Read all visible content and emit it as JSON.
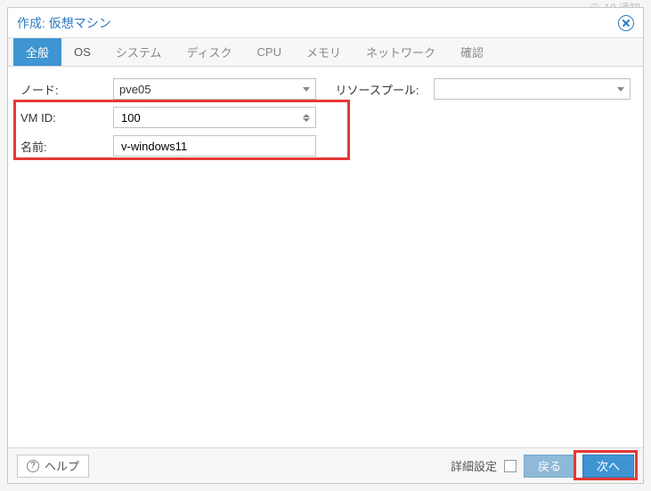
{
  "masked_top": "10 通知",
  "title": "作成: 仮想マシン",
  "tabs": [
    {
      "label": "全般",
      "active": true
    },
    {
      "label": "OS"
    },
    {
      "label": "システム"
    },
    {
      "label": "ディスク"
    },
    {
      "label": "CPU"
    },
    {
      "label": "メモリ"
    },
    {
      "label": "ネットワーク"
    },
    {
      "label": "確認"
    }
  ],
  "form": {
    "node_label": "ノード:",
    "node_value": "pve05",
    "vmid_label": "VM ID:",
    "vmid_value": "100",
    "name_label": "名前:",
    "name_value": "v-windows11",
    "pool_label": "リソースプール:",
    "pool_value": ""
  },
  "footer": {
    "help": "ヘルプ",
    "advanced": "詳細設定",
    "advanced_checked": false,
    "back": "戻る",
    "next": "次へ"
  }
}
